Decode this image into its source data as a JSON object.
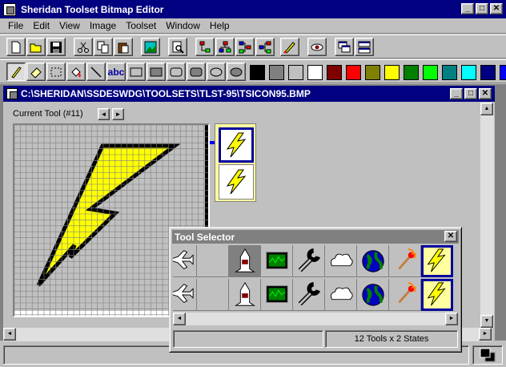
{
  "app": {
    "title": "Sheridan Toolset Bitmap Editor",
    "min": "_",
    "max": "□",
    "close": "✕"
  },
  "menu": [
    "File",
    "Edit",
    "View",
    "Image",
    "Toolset",
    "Window",
    "Help"
  ],
  "toolbar1": [
    "new-icon",
    "open-icon",
    "save-icon",
    "cut-icon",
    "copy-icon",
    "paste-icon",
    "image-icon",
    "zoom-page-icon",
    "tree-icon",
    "tree2-icon",
    "tree3-icon",
    "tree4-icon",
    "edit-icon",
    "eye-icon",
    "window-icon",
    "split-icon"
  ],
  "toolbar2": [
    "pencil-icon",
    "eraser-icon",
    "select-rect-icon",
    "fill-icon",
    "line-icon",
    "text-icon",
    "rect-icon",
    "filled-rect-icon",
    "round-rect-icon",
    "filled-round-rect-icon",
    "ellipse-icon",
    "filled-ellipse-icon"
  ],
  "text_tool_label": "abc",
  "colors": [
    "#000000",
    "#808080",
    "#c0c0c0",
    "#ffffff",
    "#800000",
    "#ff0000",
    "#808000",
    "#ffff00",
    "#008000",
    "#00ff00",
    "#008080",
    "#00ffff",
    "#000080",
    "#0000ff"
  ],
  "doc": {
    "title": "C:\\SHERIDAN\\SSDESWDG\\TOOLSETS\\TLST-95\\TSICON95.BMP",
    "min": "_",
    "max": "□",
    "close": "✕"
  },
  "current_tool": {
    "label": "Current Tool (#11)",
    "prev": "◄",
    "next": "►"
  },
  "selector": {
    "title": "Tool Selector",
    "close": "✕",
    "row1": [
      "airplane-icon",
      "blank",
      "shuttle-icon",
      "oscilloscope-icon",
      "wrench-icon",
      "cloud-icon",
      "globe-icon",
      "match-icon",
      "lightning-icon"
    ],
    "row2": [
      "airplane-icon",
      "blank",
      "shuttle-icon",
      "oscilloscope-icon",
      "wrench-icon",
      "cloud-icon",
      "globe-icon",
      "match-icon",
      "lightning-icon"
    ],
    "status": "12 Tools x 2 States"
  },
  "scroll": {
    "left": "◄",
    "right": "►",
    "up": "▲",
    "down": "▼"
  }
}
